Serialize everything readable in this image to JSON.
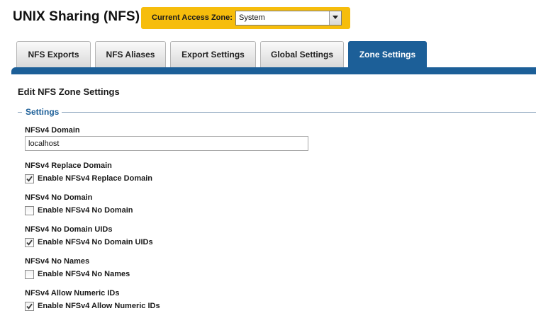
{
  "header": {
    "title": "UNIX Sharing (NFS)",
    "zone_label": "Current Access Zone:",
    "zone_value": "System"
  },
  "tabs": [
    {
      "label": "NFS Exports",
      "active": false
    },
    {
      "label": "NFS Aliases",
      "active": false
    },
    {
      "label": "Export Settings",
      "active": false
    },
    {
      "label": "Global Settings",
      "active": false
    },
    {
      "label": "Zone Settings",
      "active": true
    }
  ],
  "main": {
    "heading": "Edit NFS Zone Settings",
    "fieldset_legend": "Settings",
    "domain": {
      "label": "NFSv4 Domain",
      "value": "localhost"
    },
    "options": [
      {
        "label": "NFSv4 Replace Domain",
        "checkbox_label": "Enable NFSv4 Replace Domain",
        "checked": true
      },
      {
        "label": "NFSv4 No Domain",
        "checkbox_label": "Enable NFSv4 No Domain",
        "checked": false
      },
      {
        "label": "NFSv4 No Domain UIDs",
        "checkbox_label": "Enable NFSv4 No Domain UIDs",
        "checked": true
      },
      {
        "label": "NFSv4 No Names",
        "checkbox_label": "Enable NFSv4 No Names",
        "checked": false
      },
      {
        "label": "NFSv4 Allow Numeric IDs",
        "checkbox_label": "Enable NFSv4 Allow Numeric IDs",
        "checked": true
      }
    ]
  },
  "colors": {
    "accent": "#1c5f98",
    "zone_background": "#f6bd0c"
  },
  "icons": {
    "select_arrow": "chevron-down-icon",
    "check": "check-icon"
  }
}
